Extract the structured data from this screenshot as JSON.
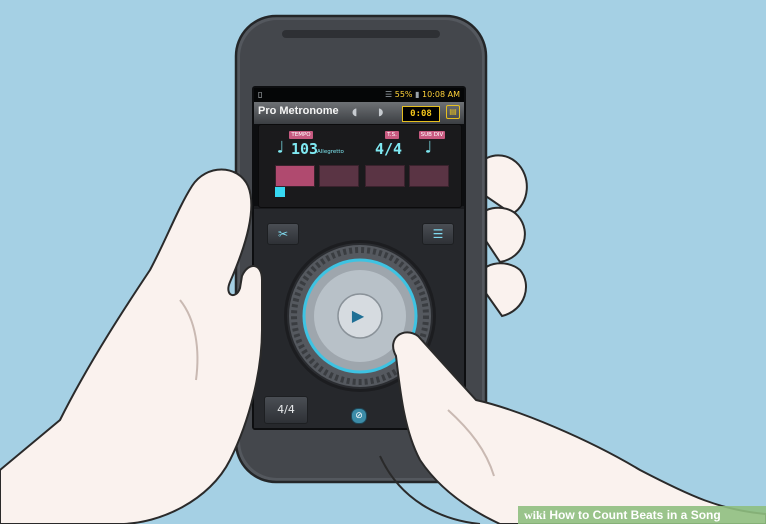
{
  "status_bar": {
    "time": "10:08 AM",
    "battery": "55%",
    "left_icon": "sd-card-icon",
    "signal_icon": "signal-icon"
  },
  "app": {
    "title": "Pro Metronome",
    "timer": "0:08"
  },
  "display": {
    "tempo_label": "TEMPO",
    "tempo_value": "103",
    "tempo_name": "Allegretto",
    "time_sig_label": "T.S.",
    "time_sig_value": "4/4",
    "subdiv_label": "SUB DIV"
  },
  "controls": {
    "time_sig_button": "4/4"
  },
  "watermark": {
    "brand": "wiki",
    "text": "How to Count Beats in a Song"
  },
  "colors": {
    "background": "#a3cfe3",
    "accent_cyan": "#7fe9f2",
    "accent_pink": "#c75a80",
    "timer_yellow": "#f2c51b"
  }
}
